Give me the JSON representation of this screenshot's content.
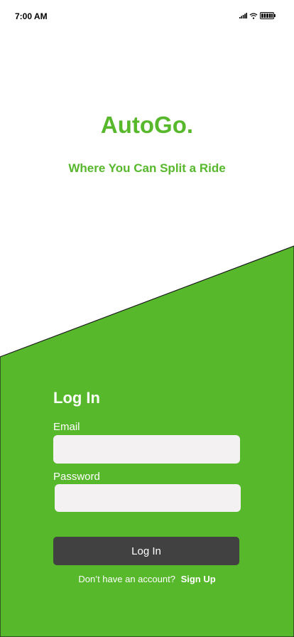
{
  "status_bar": {
    "time": "7:00 AM",
    "icons": [
      "signal-icon",
      "wifi-icon",
      "battery-icon"
    ]
  },
  "brand": {
    "title": "AutoGo.",
    "tagline": "Where You Can Split a Ride"
  },
  "login": {
    "heading": "Log In",
    "email_label": "Email",
    "email_value": "",
    "email_placeholder": "",
    "password_label": "Password",
    "password_value": "",
    "password_placeholder": "",
    "button_label": "Log In",
    "signup_prompt": "Don’t have an account?",
    "signup_link": "Sign Up"
  },
  "colors": {
    "brand_green": "#57b82c",
    "field_bg": "#f3f1f2",
    "button_bg": "#414141",
    "text_white": "#ffffff"
  }
}
